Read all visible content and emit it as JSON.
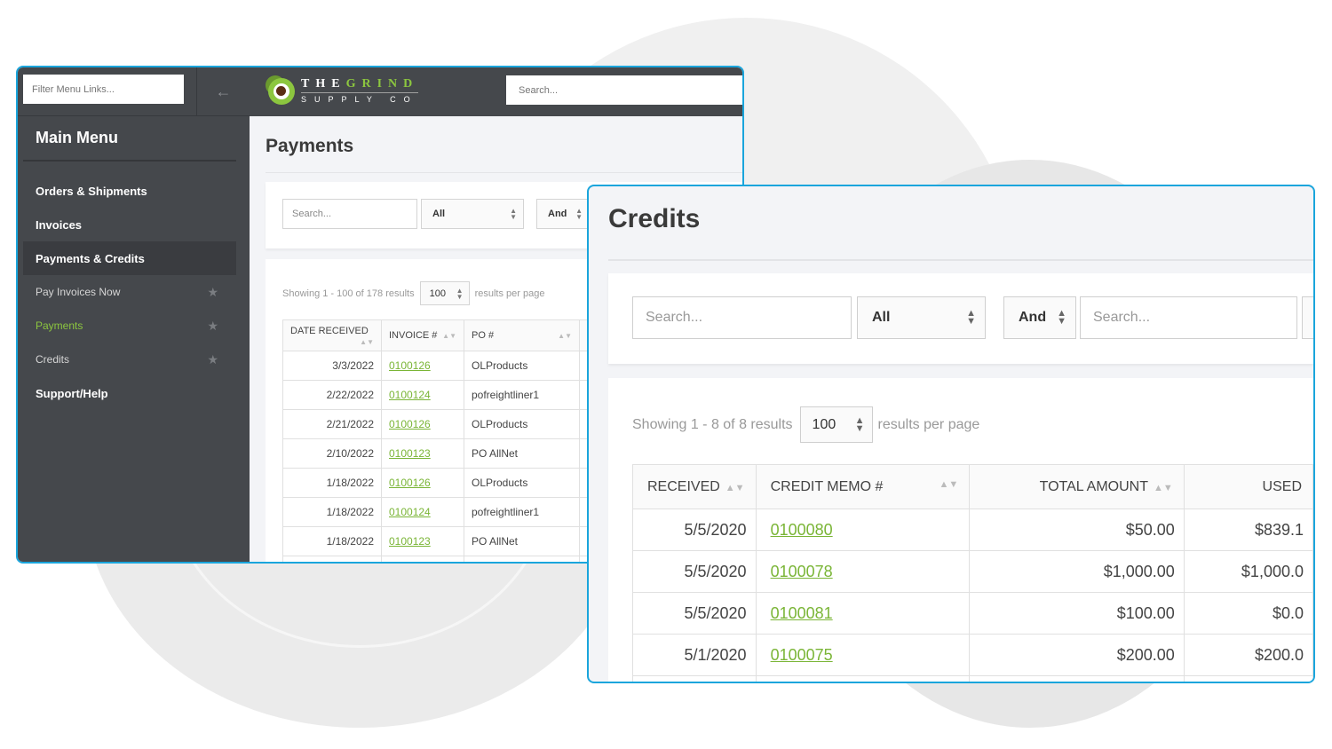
{
  "payments_window": {
    "sidebar": {
      "filter_placeholder": "Filter Menu Links...",
      "back_icon": "arrow-left-icon",
      "title": "Main Menu",
      "items": [
        {
          "label": "Orders & Shipments",
          "type": "section"
        },
        {
          "label": "Invoices",
          "type": "section"
        },
        {
          "label": "Payments & Credits",
          "type": "section",
          "active": true
        },
        {
          "label": "Pay Invoices Now",
          "type": "sub",
          "icon": "star-icon"
        },
        {
          "label": "Payments",
          "type": "sub",
          "icon": "star-icon",
          "current": true
        },
        {
          "label": "Credits",
          "type": "sub",
          "icon": "star-icon"
        },
        {
          "label": "Support/Help",
          "type": "section"
        }
      ]
    },
    "topbar": {
      "logo_line1_a": "THE",
      "logo_line1_b": "GRIND",
      "logo_line2": "SUPPLY CO",
      "search_placeholder": "Search..."
    },
    "page_title": "Payments",
    "filters": {
      "search_placeholder": "Search...",
      "field_select": "All",
      "logic_select": "And"
    },
    "results": {
      "showing_text": "Showing 1 - 100 of 178 results",
      "per_page": "100",
      "per_page_suffix": "results per page"
    },
    "table": {
      "columns": [
        "DATE RECEIVED",
        "INVOICE #",
        "PO #"
      ],
      "rows": [
        {
          "date": "3/3/2022",
          "invoice": "0100126",
          "po": "OLProducts"
        },
        {
          "date": "2/22/2022",
          "invoice": "0100124",
          "po": "pofreightliner1"
        },
        {
          "date": "2/21/2022",
          "invoice": "0100126",
          "po": "OLProducts"
        },
        {
          "date": "2/10/2022",
          "invoice": "0100123",
          "po": "PO AllNet"
        },
        {
          "date": "1/18/2022",
          "invoice": "0100126",
          "po": "OLProducts"
        },
        {
          "date": "1/18/2022",
          "invoice": "0100124",
          "po": "pofreightliner1"
        },
        {
          "date": "1/18/2022",
          "invoice": "0100123",
          "po": "PO AllNet"
        }
      ]
    }
  },
  "credits_window": {
    "page_title": "Credits",
    "filters": {
      "search_placeholder": "Search...",
      "field_select": "All",
      "logic_select": "And",
      "search2_placeholder": "Search..."
    },
    "results": {
      "showing_text": "Showing 1 - 8 of 8 results",
      "per_page": "100",
      "per_page_suffix": "results per page"
    },
    "table": {
      "columns": [
        "RECEIVED",
        "CREDIT MEMO #",
        "TOTAL AMOUNT",
        "USED"
      ],
      "rows": [
        {
          "received": "5/5/2020",
          "memo": "0100080",
          "total": "$50.00",
          "used": "$839.1"
        },
        {
          "received": "5/5/2020",
          "memo": "0100078",
          "total": "$1,000.00",
          "used": "$1,000.0"
        },
        {
          "received": "5/5/2020",
          "memo": "0100081",
          "total": "$100.00",
          "used": "$0.0"
        },
        {
          "received": "5/1/2020",
          "memo": "0100075",
          "total": "$200.00",
          "used": "$200.0"
        }
      ]
    }
  },
  "colors": {
    "accent_green": "#8cc63f",
    "link_green": "#7ab536",
    "window_border_blue": "#1aa5dc",
    "sidebar_bg": "#45484c"
  }
}
